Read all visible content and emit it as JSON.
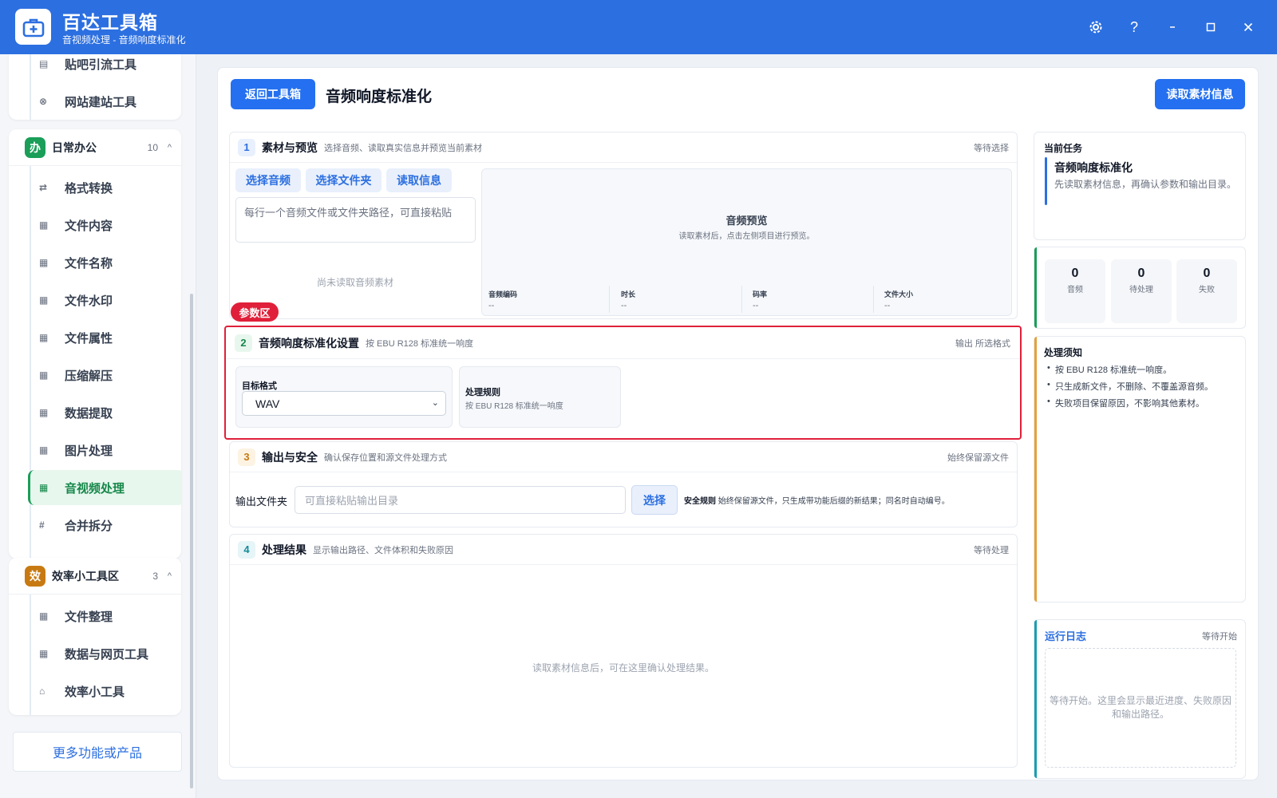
{
  "app": {
    "title": "百达工具箱",
    "subtitle": "音视频处理 - 音频响度标准化",
    "controls": [
      "settings-icon",
      "help-icon",
      "minimize-icon",
      "maximize-icon",
      "close-icon"
    ]
  },
  "sidebar": {
    "top_group_items": [
      {
        "label": "贴吧引流工具",
        "icon": "doc-icon"
      },
      {
        "label": "网站建站工具",
        "icon": "globe-icon"
      }
    ],
    "office_group": {
      "badge": "办",
      "badge_color": "#1a9e58",
      "title": "日常办公",
      "count": "10",
      "items": [
        {
          "label": "格式转换",
          "icon": "swap-icon"
        },
        {
          "label": "文件内容",
          "icon": "grid-icon"
        },
        {
          "label": "文件名称",
          "icon": "grid-icon"
        },
        {
          "label": "文件水印",
          "icon": "grid-icon"
        },
        {
          "label": "文件属性",
          "icon": "grid-icon"
        },
        {
          "label": "压缩解压",
          "icon": "grid-icon"
        },
        {
          "label": "数据提取",
          "icon": "grid-icon"
        },
        {
          "label": "图片处理",
          "icon": "grid-icon"
        },
        {
          "label": "音视频处理",
          "icon": "grid-icon",
          "active": true
        },
        {
          "label": "合并拆分",
          "icon": "hash-icon"
        }
      ]
    },
    "efficiency_group": {
      "badge": "效",
      "badge_color": "#c77a12",
      "title": "效率小工具区",
      "count": "3",
      "items": [
        {
          "label": "文件整理",
          "icon": "grid-icon"
        },
        {
          "label": "数据与网页工具",
          "icon": "grid-icon"
        },
        {
          "label": "效率小工具",
          "icon": "toolbox-icon"
        }
      ]
    },
    "more_label": "更多功能或产品"
  },
  "header": {
    "back_label": "返回工具箱",
    "page_title": "音频响度标准化",
    "read_info_label": "读取素材信息"
  },
  "section1": {
    "num": "1",
    "title": "素材与预览",
    "desc": "选择音频、读取真实信息并预览当前素材",
    "status": "等待选择",
    "buttons": [
      "选择音频",
      "选择文件夹",
      "读取信息"
    ],
    "placeholder": "每行一个音频文件或文件夹路径，可直接粘贴",
    "empty": "尚未读取音频素材",
    "preview_title": "音频预览",
    "preview_desc": "读取素材后，点击左侧项目进行预览。",
    "meta": [
      {
        "k": "音频编码",
        "v": "--"
      },
      {
        "k": "时长",
        "v": "--"
      },
      {
        "k": "码率",
        "v": "--"
      },
      {
        "k": "文件大小",
        "v": "--"
      }
    ]
  },
  "param_tag": "参数区",
  "section2": {
    "num": "2",
    "title": "音频响度标准化设置",
    "desc": "按 EBU R128 标准统一响度",
    "status": "输出 所选格式",
    "format_label": "目标格式",
    "format_value": "WAV",
    "rule_label": "处理规则",
    "rule_value": "按 EBU R128 标准统一响度"
  },
  "section3": {
    "num": "3",
    "title": "输出与安全",
    "desc": "确认保存位置和源文件处理方式",
    "status": "始终保留源文件",
    "output_label": "输出文件夹",
    "output_placeholder": "可直接粘贴输出目录",
    "choose_label": "选择",
    "safety_label": "安全规则",
    "safety_text": "始终保留源文件，只生成带功能后缀的新结果；同名时自动编号。"
  },
  "section4": {
    "num": "4",
    "title": "处理结果",
    "desc": "显示输出路径、文件体积和失败原因",
    "status": "等待处理",
    "empty": "读取素材信息后，可在这里确认处理结果。"
  },
  "task": {
    "label": "当前任务",
    "title": "音频响度标准化",
    "desc": "先读取素材信息，再确认参数和输出目录。"
  },
  "stats": [
    {
      "n": "0",
      "l": "音频"
    },
    {
      "n": "0",
      "l": "待处理"
    },
    {
      "n": "0",
      "l": "失败"
    }
  ],
  "notes": {
    "title": "处理须知",
    "items": [
      "按 EBU R128 标准统一响度。",
      "只生成新文件，不删除、不覆盖源音频。",
      "失败项目保留原因，不影响其他素材。"
    ]
  },
  "log": {
    "title": "运行日志",
    "status": "等待开始",
    "empty": "等待开始。这里会显示最近进度、失败原因和输出路径。"
  },
  "colors": {
    "titlebar": "#2c6fe0",
    "primary": "#2470f0",
    "highlight": "#e0203a",
    "active_green": "#16884a"
  }
}
